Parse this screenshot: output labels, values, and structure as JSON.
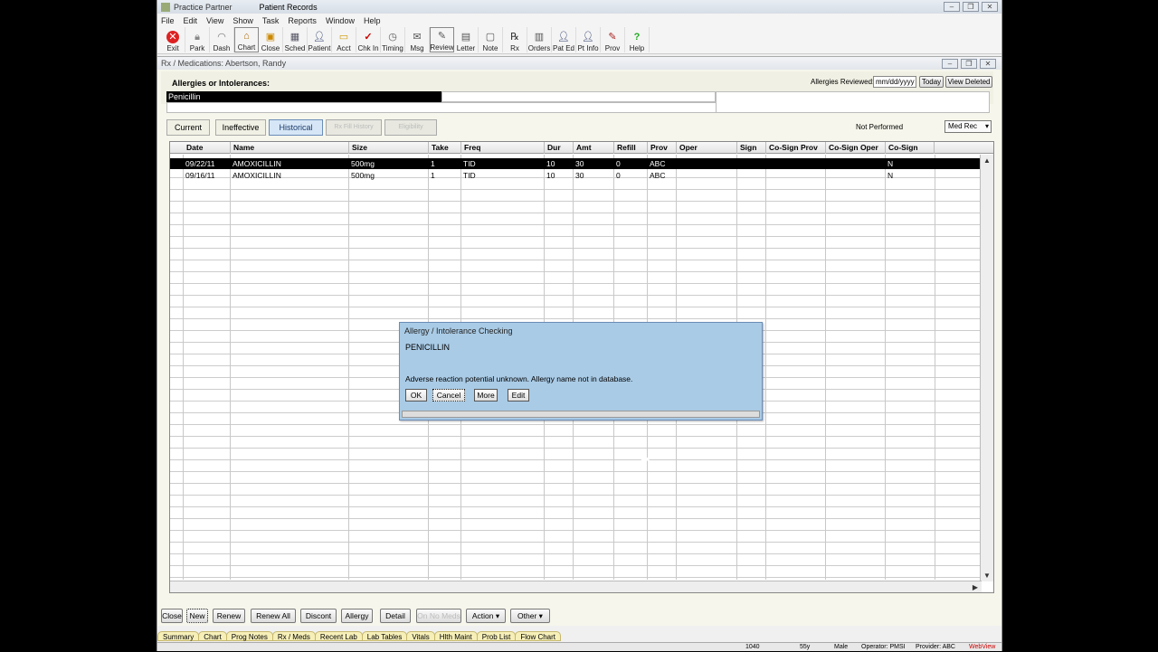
{
  "app": {
    "title": "Practice Partner",
    "module": "Patient Records"
  },
  "menu": [
    "File",
    "Edit",
    "View",
    "Show",
    "Task",
    "Reports",
    "Window",
    "Help"
  ],
  "toolbar": [
    {
      "label": "Exit",
      "icon": "exit-icon"
    },
    {
      "label": "Park",
      "icon": "lock-icon"
    },
    {
      "label": "Dash",
      "icon": "dashboard-icon"
    },
    {
      "label": "Chart",
      "icon": "chart-icon"
    },
    {
      "label": "Close",
      "icon": "close-chart-icon"
    },
    {
      "label": "Sched",
      "icon": "calendar-icon"
    },
    {
      "label": "Patient",
      "icon": "patient-icon"
    },
    {
      "label": "Acct",
      "icon": "folder-icon"
    },
    {
      "label": "Chk In",
      "icon": "checkmark-icon"
    },
    {
      "label": "Timing",
      "icon": "clock-icon"
    },
    {
      "label": "Msg",
      "icon": "message-icon"
    },
    {
      "label": "Review",
      "icon": "review-icon"
    },
    {
      "label": "Letter",
      "icon": "letter-icon"
    },
    {
      "label": "Note",
      "icon": "note-icon"
    },
    {
      "label": "Rx",
      "icon": "rx-icon"
    },
    {
      "label": "Orders",
      "icon": "orders-icon"
    },
    {
      "label": "Pat Ed",
      "icon": "pat-ed-icon"
    },
    {
      "label": "Pt Info",
      "icon": "pt-info-icon"
    },
    {
      "label": "Prov",
      "icon": "provider-icon"
    },
    {
      "label": "Help",
      "icon": "help-icon"
    }
  ],
  "child": {
    "title": "Rx / Medications: Abertson, Randy"
  },
  "allergies": {
    "label": "Allergies or Intolerances:",
    "items": [
      "Penicillin"
    ],
    "reviewed_label": "Allergies Reviewed:",
    "reviewed_placeholder": "mm/dd/yyyy",
    "today_label": "Today",
    "view_deleted_label": "View Deleted"
  },
  "tabs": [
    {
      "label": "Current"
    },
    {
      "label": "Ineffective"
    },
    {
      "label": "Historical"
    },
    {
      "label": "Rx Fill History"
    },
    {
      "label": "Eligibility"
    }
  ],
  "not_performed": "Not Performed",
  "med_rec": "Med Rec",
  "grid": {
    "columns": [
      "Date",
      "Name",
      "Size",
      "Take",
      "Freq",
      "Dur",
      "Amt",
      "Refill",
      "Prov",
      "Oper",
      "Sign",
      "Co-Sign Prov",
      "Co-Sign Oper",
      "Co-Sign"
    ],
    "rows": [
      [
        "09/22/11",
        "AMOXICILLIN",
        "500mg",
        "1",
        "TID",
        "10",
        "30",
        "0",
        "ABC",
        "",
        "",
        "",
        "",
        "N"
      ],
      [
        "09/16/11",
        "AMOXICILLIN",
        "500mg",
        "1",
        "TID",
        "10",
        "30",
        "0",
        "ABC",
        "",
        "",
        "",
        "",
        "N"
      ]
    ]
  },
  "bottom_buttons": [
    {
      "label": "Close"
    },
    {
      "label": "New"
    },
    {
      "label": "Renew"
    },
    {
      "label": "Renew All"
    },
    {
      "label": "Discont"
    },
    {
      "label": "Allergy"
    },
    {
      "label": "Detail"
    },
    {
      "label": "On No Meds"
    },
    {
      "label": "Action"
    },
    {
      "label": "Other"
    }
  ],
  "nav_tabs": [
    "Summary",
    "Chart",
    "Prog Notes",
    "Rx / Meds",
    "Recent Lab",
    "Lab Tables",
    "Vitals",
    "Hlth Maint",
    "Prob List",
    "Flow Chart"
  ],
  "status": {
    "code": "1040",
    "age": "55y",
    "sex": "Male",
    "operator": "Operator: PMSI",
    "provider": "Provider: ABC",
    "webview": "WebView"
  },
  "dialog": {
    "title": "Allergy / Intolerance Checking",
    "drug": "PENICILLIN",
    "message": "Adverse reaction potential unknown.  Allergy name not in database.",
    "ok": "OK",
    "cancel": "Cancel",
    "more": "More",
    "edit": "Edit"
  },
  "colors": {
    "selected_row": "#000000",
    "dialog_bg": "#a9cbe6",
    "nav_tab_bg": "#f6efb8"
  }
}
